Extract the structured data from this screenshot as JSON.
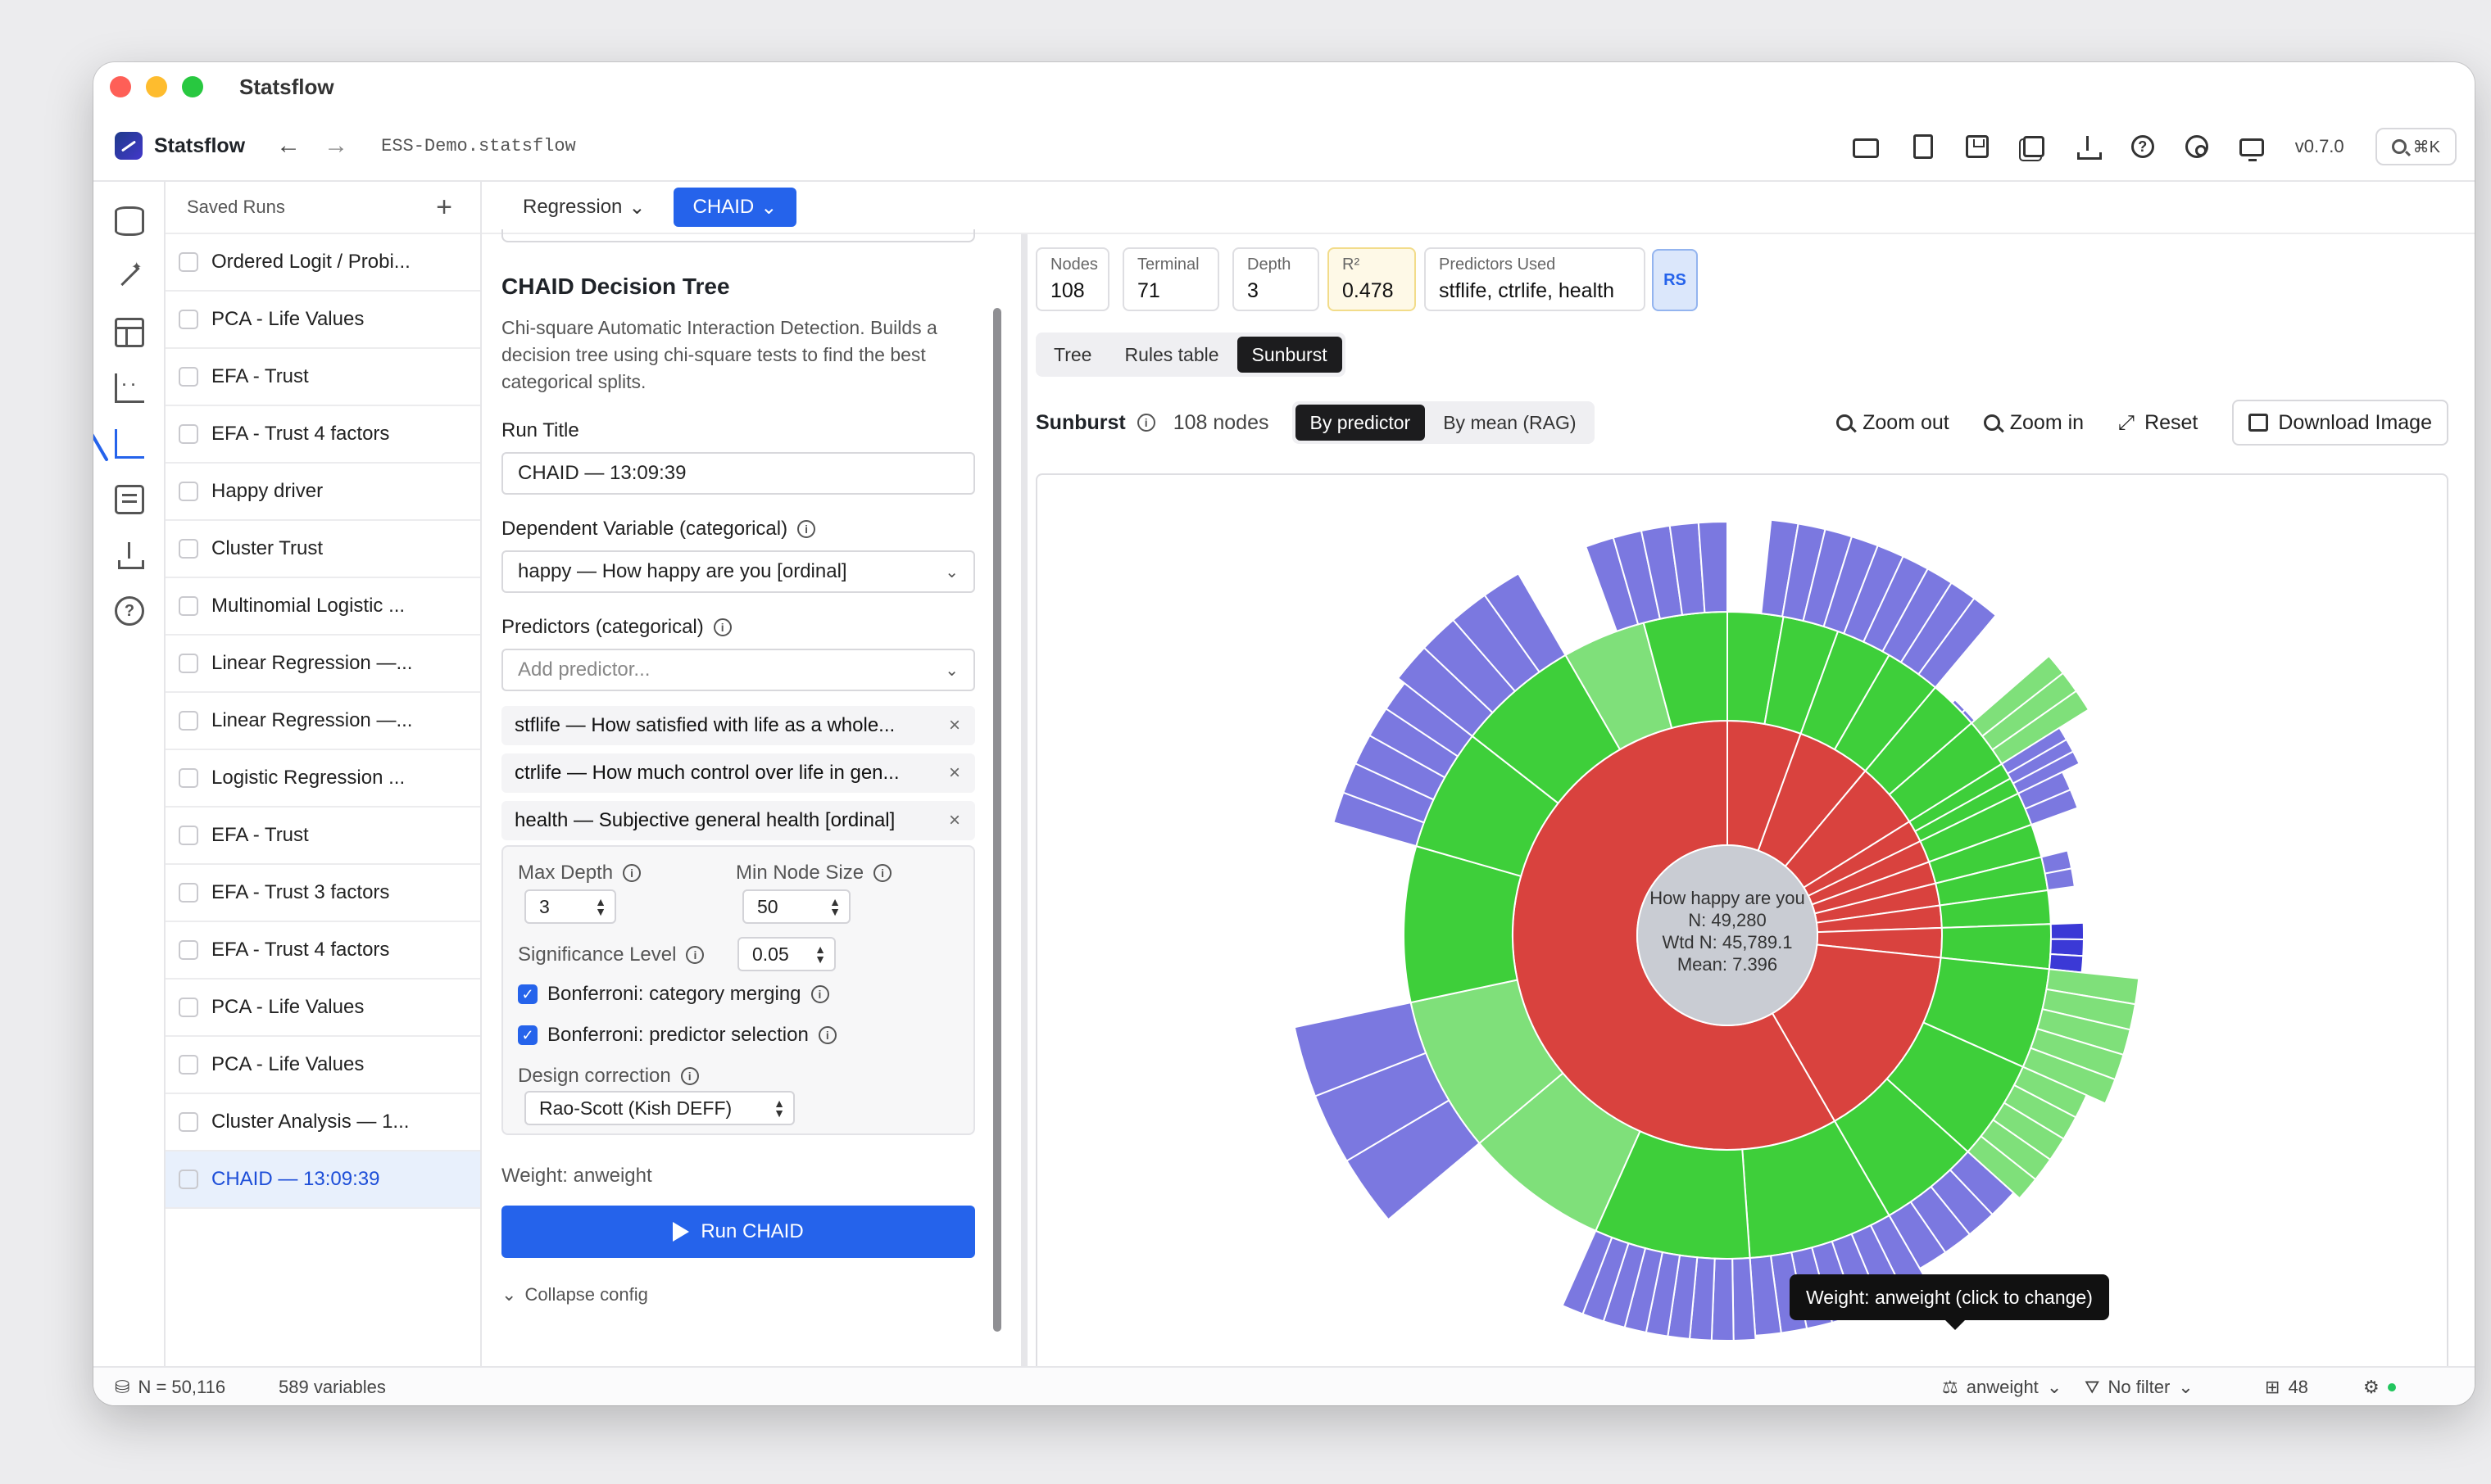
{
  "window": {
    "title": "Statsflow"
  },
  "app": {
    "brand": "Statsflow",
    "filename": "ESS-Demo.statsflow",
    "version": "v0.7.0",
    "search_shortcut": "⌘K"
  },
  "runs": {
    "title": "Saved Runs",
    "items": [
      "Ordered Logit / Probi...",
      "PCA - Life Values",
      "EFA - Trust",
      "EFA - Trust 4 factors",
      "Happy driver",
      "Cluster Trust",
      "Multinomial Logistic ...",
      "Linear Regression —...",
      "Linear Regression —...",
      "Logistic Regression ...",
      "EFA - Trust",
      "EFA - Trust 3 factors",
      "EFA - Trust 4 factors",
      "PCA - Life Values",
      "PCA - Life Values",
      "Cluster Analysis — 1...",
      "CHAID — 13:09:39"
    ],
    "selected_index": 16
  },
  "mode": {
    "regression": "Regression",
    "chaid": "CHAID"
  },
  "config": {
    "title": "CHAID Decision Tree",
    "description": "Chi-square Automatic Interaction Detection. Builds a decision tree using chi-square tests to find the best categorical splits.",
    "run_title_label": "Run Title",
    "run_title_value": "CHAID — 13:09:39",
    "dep_label": "Dependent Variable (categorical)",
    "dep_value": "happy — How happy are you [ordinal]",
    "pred_label": "Predictors (categorical)",
    "pred_placeholder": "Add predictor...",
    "predictors": [
      "stflife — How satisfied with life as a whole...",
      "ctrlife — How much control over life in gen...",
      "health — Subjective general health [ordinal]"
    ],
    "max_depth_label": "Max Depth",
    "max_depth": "3",
    "min_node_label": "Min Node Size",
    "min_node": "50",
    "sig_label": "Significance Level",
    "sig_value": "0.05",
    "bonf_merge": "Bonferroni: category merging",
    "bonf_pred": "Bonferroni: predictor selection",
    "design_label": "Design correction",
    "design_value": "Rao-Scott (Kish DEFF)",
    "weight_line": "Weight: anweight",
    "run_button": "Run CHAID",
    "collapse": "Collapse config"
  },
  "stats": [
    {
      "key": "Nodes",
      "value": "108"
    },
    {
      "key": "Terminal",
      "value": "71"
    },
    {
      "key": "Depth",
      "value": "3"
    },
    {
      "key": "R²",
      "value": "0.478"
    },
    {
      "key": "Predictors Used",
      "value": "stflife, ctrlife, health"
    }
  ],
  "rs_badge": "RS",
  "view_tabs": [
    "Tree",
    "Rules table",
    "Sunburst"
  ],
  "sunburst": {
    "title": "Sunburst",
    "count": "108 nodes",
    "by_predictor": "By predictor",
    "by_mean": "By mean (RAG)",
    "zoom_out": "Zoom out",
    "zoom_in": "Zoom in",
    "reset": "Reset",
    "download": "Download Image",
    "center_lines": [
      "How happy are you",
      "N: 49,280",
      "Wtd N: 45,789.1",
      "Mean: 7.396"
    ]
  },
  "chart_data": {
    "type": "sunburst",
    "root": {
      "label": "How happy are you",
      "n": 49280,
      "wtd_n": 45789.1,
      "mean": 7.396
    },
    "levels": [
      {
        "depth": 1,
        "predictor": "stflife",
        "node_count": 11,
        "color": "#d9423e"
      },
      {
        "depth": 2,
        "predictor": "ctrlife / health",
        "node_count": 26,
        "color": "#3ecf3a"
      },
      {
        "depth": 3,
        "predictor": "health",
        "node_count": 71,
        "color": "#7b78e0"
      }
    ],
    "colors": {
      "level1": "#d9423e",
      "level2": "#3ecf3a",
      "level2_light": "#7fe07a",
      "level3": "#7b78e0",
      "level3_dark": "#3b39d6",
      "center": "#c9ccd3"
    }
  },
  "status": {
    "n": "N = 50,116",
    "vars": "589 variables",
    "weight": "anweight",
    "filter": "No filter",
    "count": "48"
  },
  "tooltip": "Weight: anweight (click to change)"
}
